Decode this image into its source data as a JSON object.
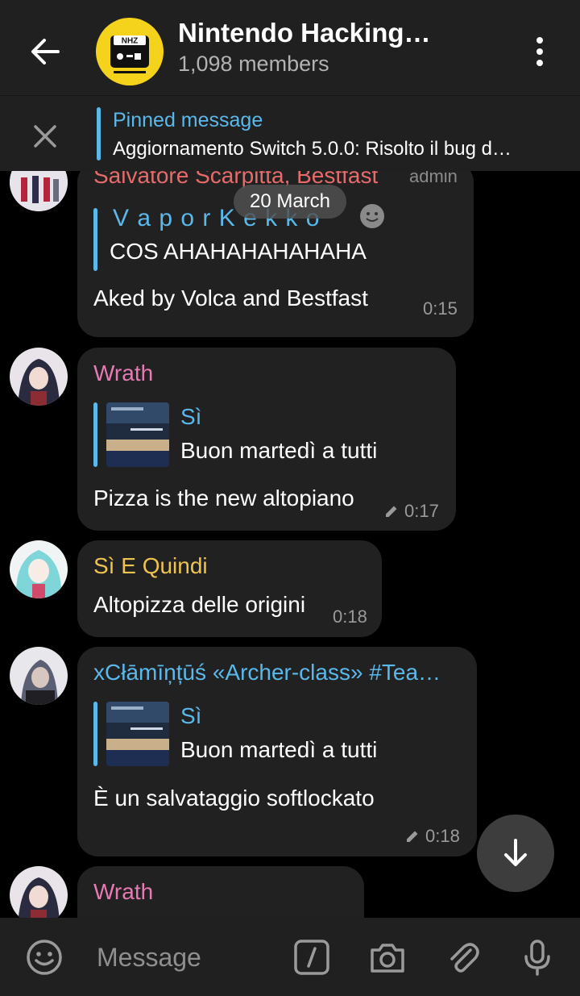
{
  "header": {
    "title": "Nintendo Hacking…",
    "subtitle": "1,098 members",
    "avatar_text": "NHZ"
  },
  "pinned": {
    "label": "Pinned message",
    "text": "Aggiornamento Switch 5.0.0:  Risolto il bug d…"
  },
  "date_pill": "20 March",
  "messages": [
    {
      "sender": "Salvatore Scarpitta, Bestfast",
      "sender_color": "#e66b6b",
      "badge": "admin",
      "reply_name": "V a p o r K e k k o",
      "reply_text": "COS  AHAHAHAHAHAHA",
      "text": "Aked by Volca and Bestfast",
      "time": "0:15"
    },
    {
      "sender": "Wrath",
      "sender_color": "#e67bb4",
      "reply_name": "Sì",
      "reply_text": "Buon martedì a tutti",
      "text": "Pizza is the new altopiano",
      "time": "0:17"
    },
    {
      "sender": "Sì E Quindi",
      "sender_color": "#efc34f",
      "text": "Altopizza delle origini",
      "time": "0:18"
    },
    {
      "sender": "xCłāmīņțūś «Archer-class» #Tea…",
      "sender_color": "#5ab8ea",
      "reply_name": "Sì",
      "reply_text": "Buon martedì a tutti",
      "text": "È un salvataggio softlockato",
      "time": "0:18"
    },
    {
      "sender": "Wrath",
      "sender_color": "#e67bb4"
    }
  ],
  "composer": {
    "placeholder": "Message"
  },
  "colors": {
    "accent": "#5ab8ea",
    "bar_bg": "#202020",
    "bubble_bg": "#212121"
  },
  "icons": [
    "back-arrow-icon",
    "more-vert-icon",
    "close-icon",
    "emoji-icon",
    "bot-command-icon",
    "camera-icon",
    "attach-icon",
    "mic-icon",
    "arrow-down-icon",
    "edit-pencil-icon"
  ]
}
